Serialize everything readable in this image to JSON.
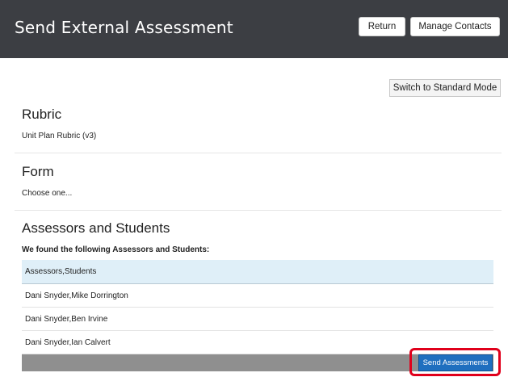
{
  "header": {
    "title": "Send External Assessment",
    "return_label": "Return",
    "manage_contacts_label": "Manage Contacts"
  },
  "mode": {
    "switch_label": "Switch to Standard Mode"
  },
  "rubric": {
    "title": "Rubric",
    "value": "Unit Plan Rubric (v3)"
  },
  "form": {
    "title": "Form",
    "value": "Choose one..."
  },
  "assessors": {
    "title": "Assessors and Students",
    "found_text": "We found the following Assessors and Students:",
    "table_header": "Assessors,Students",
    "rows": [
      "Dani Snyder,Mike Dorrington",
      "Dani Snyder,Ben Irvine",
      "Dani Snyder,Ian Calvert"
    ]
  },
  "actions": {
    "send_label": "Send Assessments"
  },
  "colors": {
    "topbar": "#3c3e43",
    "table_header": "#dfeff8",
    "send_button": "#1f6fbf",
    "highlight": "#e0001b"
  }
}
